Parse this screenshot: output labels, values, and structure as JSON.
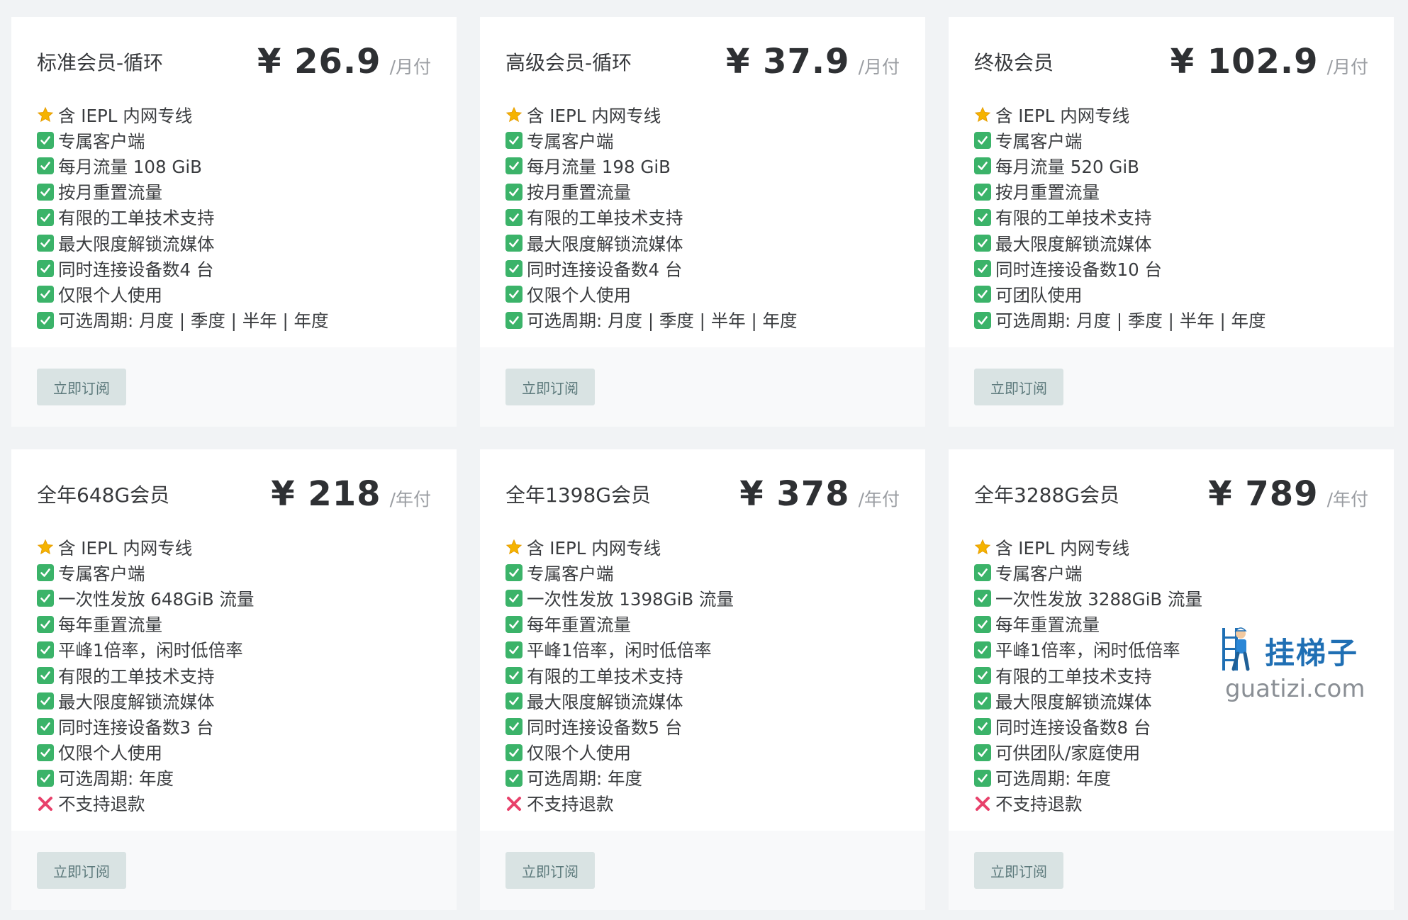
{
  "plans": [
    {
      "name": "标准会员-循环",
      "price": "¥ 26.9",
      "period": "/月付",
      "features": [
        {
          "icon": "star",
          "text": "含 IEPL 内网专线"
        },
        {
          "icon": "check",
          "text": "专属客户端"
        },
        {
          "icon": "check",
          "text": "每月流量 108 GiB"
        },
        {
          "icon": "check",
          "text": "按月重置流量"
        },
        {
          "icon": "check",
          "text": "有限的工单技术支持"
        },
        {
          "icon": "check",
          "text": "最大限度解锁流媒体"
        },
        {
          "icon": "check",
          "text": "同时连接设备数4 台"
        },
        {
          "icon": "check",
          "text": "仅限个人使用"
        },
        {
          "icon": "check",
          "text": "可选周期: 月度 | 季度 | 半年 | 年度"
        }
      ],
      "button": "立即订阅"
    },
    {
      "name": "高级会员-循环",
      "price": "¥ 37.9",
      "period": "/月付",
      "features": [
        {
          "icon": "star",
          "text": "含 IEPL 内网专线"
        },
        {
          "icon": "check",
          "text": "专属客户端"
        },
        {
          "icon": "check",
          "text": "每月流量 198 GiB"
        },
        {
          "icon": "check",
          "text": "按月重置流量"
        },
        {
          "icon": "check",
          "text": "有限的工单技术支持"
        },
        {
          "icon": "check",
          "text": "最大限度解锁流媒体"
        },
        {
          "icon": "check",
          "text": "同时连接设备数4 台"
        },
        {
          "icon": "check",
          "text": "仅限个人使用"
        },
        {
          "icon": "check",
          "text": "可选周期: 月度 | 季度 | 半年 | 年度"
        }
      ],
      "button": "立即订阅"
    },
    {
      "name": "终极会员",
      "price": "¥ 102.9",
      "period": "/月付",
      "features": [
        {
          "icon": "star",
          "text": "含 IEPL 内网专线"
        },
        {
          "icon": "check",
          "text": "专属客户端"
        },
        {
          "icon": "check",
          "text": "每月流量 520 GiB"
        },
        {
          "icon": "check",
          "text": "按月重置流量"
        },
        {
          "icon": "check",
          "text": "有限的工单技术支持"
        },
        {
          "icon": "check",
          "text": "最大限度解锁流媒体"
        },
        {
          "icon": "check",
          "text": "同时连接设备数10 台"
        },
        {
          "icon": "check",
          "text": "可团队使用"
        },
        {
          "icon": "check",
          "text": "可选周期: 月度 | 季度 | 半年 | 年度"
        }
      ],
      "button": "立即订阅"
    },
    {
      "name": "全年648G会员",
      "price": "¥ 218",
      "period": "/年付",
      "features": [
        {
          "icon": "star",
          "text": "含 IEPL 内网专线"
        },
        {
          "icon": "check",
          "text": "专属客户端"
        },
        {
          "icon": "check",
          "text": "一次性发放 648GiB 流量"
        },
        {
          "icon": "check",
          "text": "每年重置流量"
        },
        {
          "icon": "check",
          "text": "平峰1倍率，闲时低倍率"
        },
        {
          "icon": "check",
          "text": "有限的工单技术支持"
        },
        {
          "icon": "check",
          "text": "最大限度解锁流媒体"
        },
        {
          "icon": "check",
          "text": "同时连接设备数3 台"
        },
        {
          "icon": "check",
          "text": "仅限个人使用"
        },
        {
          "icon": "check",
          "text": "可选周期: 年度"
        },
        {
          "icon": "cross",
          "text": "不支持退款"
        }
      ],
      "button": "立即订阅"
    },
    {
      "name": "全年1398G会员",
      "price": "¥ 378",
      "period": "/年付",
      "features": [
        {
          "icon": "star",
          "text": "含 IEPL 内网专线"
        },
        {
          "icon": "check",
          "text": "专属客户端"
        },
        {
          "icon": "check",
          "text": "一次性发放 1398GiB 流量"
        },
        {
          "icon": "check",
          "text": "每年重置流量"
        },
        {
          "icon": "check",
          "text": "平峰1倍率，闲时低倍率"
        },
        {
          "icon": "check",
          "text": "有限的工单技术支持"
        },
        {
          "icon": "check",
          "text": "最大限度解锁流媒体"
        },
        {
          "icon": "check",
          "text": "同时连接设备数5 台"
        },
        {
          "icon": "check",
          "text": "仅限个人使用"
        },
        {
          "icon": "check",
          "text": "可选周期: 年度"
        },
        {
          "icon": "cross",
          "text": "不支持退款"
        }
      ],
      "button": "立即订阅"
    },
    {
      "name": "全年3288G会员",
      "price": "¥ 789",
      "period": "/年付",
      "features": [
        {
          "icon": "star",
          "text": "含 IEPL 内网专线"
        },
        {
          "icon": "check",
          "text": "专属客户端"
        },
        {
          "icon": "check",
          "text": "一次性发放 3288GiB 流量"
        },
        {
          "icon": "check",
          "text": "每年重置流量"
        },
        {
          "icon": "check",
          "text": "平峰1倍率，闲时低倍率"
        },
        {
          "icon": "check",
          "text": "有限的工单技术支持"
        },
        {
          "icon": "check",
          "text": "最大限度解锁流媒体"
        },
        {
          "icon": "check",
          "text": "同时连接设备数8 台"
        },
        {
          "icon": "check",
          "text": "可供团队/家庭使用"
        },
        {
          "icon": "check",
          "text": "可选周期: 年度"
        },
        {
          "icon": "cross",
          "text": "不支持退款"
        }
      ],
      "button": "立即订阅"
    }
  ],
  "watermark": {
    "title": "挂梯子",
    "subtitle": "guatizi.com"
  },
  "colors": {
    "check": "#3bb369",
    "star": "#f5b301",
    "cross": "#e8416b",
    "button_bg": "#d9e3e3",
    "button_text": "#5d7a7c"
  }
}
